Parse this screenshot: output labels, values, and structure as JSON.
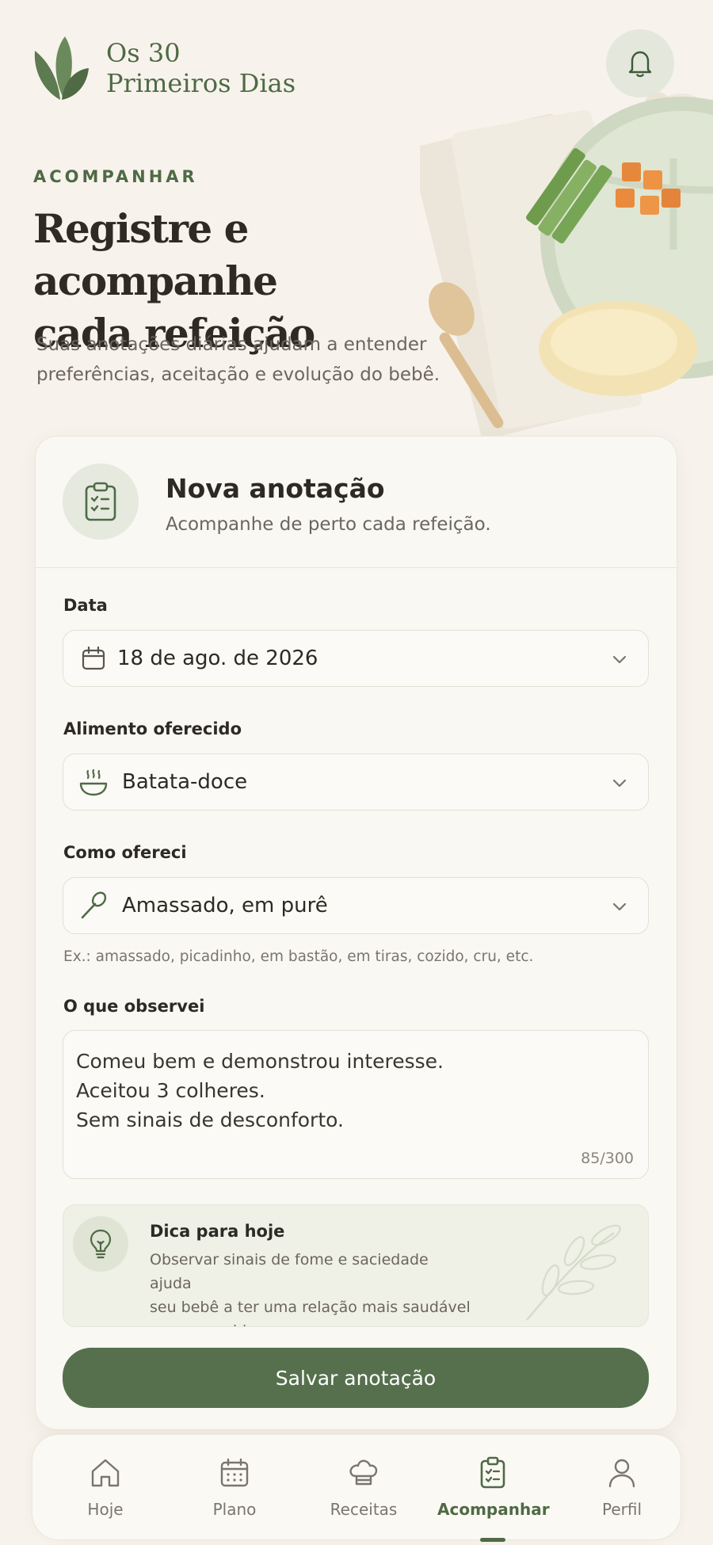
{
  "brand": {
    "line1": "Os 30",
    "line2": "Primeiros Dias"
  },
  "hero": {
    "eyebrow": "ACOMPANHAR",
    "title_line1": "Registre e acompanhe",
    "title_line2": "cada refeição",
    "subtitle_line1": "Suas anotações diárias ajudam a entender",
    "subtitle_line2": "preferências, aceitação e evolução do bebê."
  },
  "card": {
    "title": "Nova anotação",
    "description": "Acompanhe de perto cada refeição.",
    "date": {
      "label": "Data",
      "value": "18 de ago. de 2026"
    },
    "food": {
      "label": "Alimento oferecido",
      "value": "Batata-doce"
    },
    "method": {
      "label": "Como ofereci",
      "value": "Amassado, em purê",
      "hint": "Ex.: amassado, picadinho, em bastão, em tiras, cozido, cru, etc."
    },
    "notes": {
      "label": "O que observei",
      "lines": [
        "Comeu bem e demonstrou interesse.",
        "Aceitou 3 colheres.",
        "Sem sinais de desconforto."
      ],
      "counter": "85/300"
    },
    "tip": {
      "title": "Dica para hoje",
      "line1": "Observar sinais de fome e saciedade ajuda",
      "line2": "seu bebê a ter uma relação mais saudável",
      "line3": "com a comida."
    },
    "save_label": "Salvar anotação"
  },
  "nav": {
    "items": [
      {
        "label": "Hoje",
        "icon": "home-icon"
      },
      {
        "label": "Plano",
        "icon": "calendar-icon"
      },
      {
        "label": "Receitas",
        "icon": "chef-hat-icon"
      },
      {
        "label": "Acompanhar",
        "icon": "clipboard-icon",
        "active": true
      },
      {
        "label": "Perfil",
        "icon": "user-icon"
      }
    ]
  },
  "colors": {
    "accent": "#56704d",
    "background": "#f7f3ec",
    "card": "#faf8f3"
  }
}
